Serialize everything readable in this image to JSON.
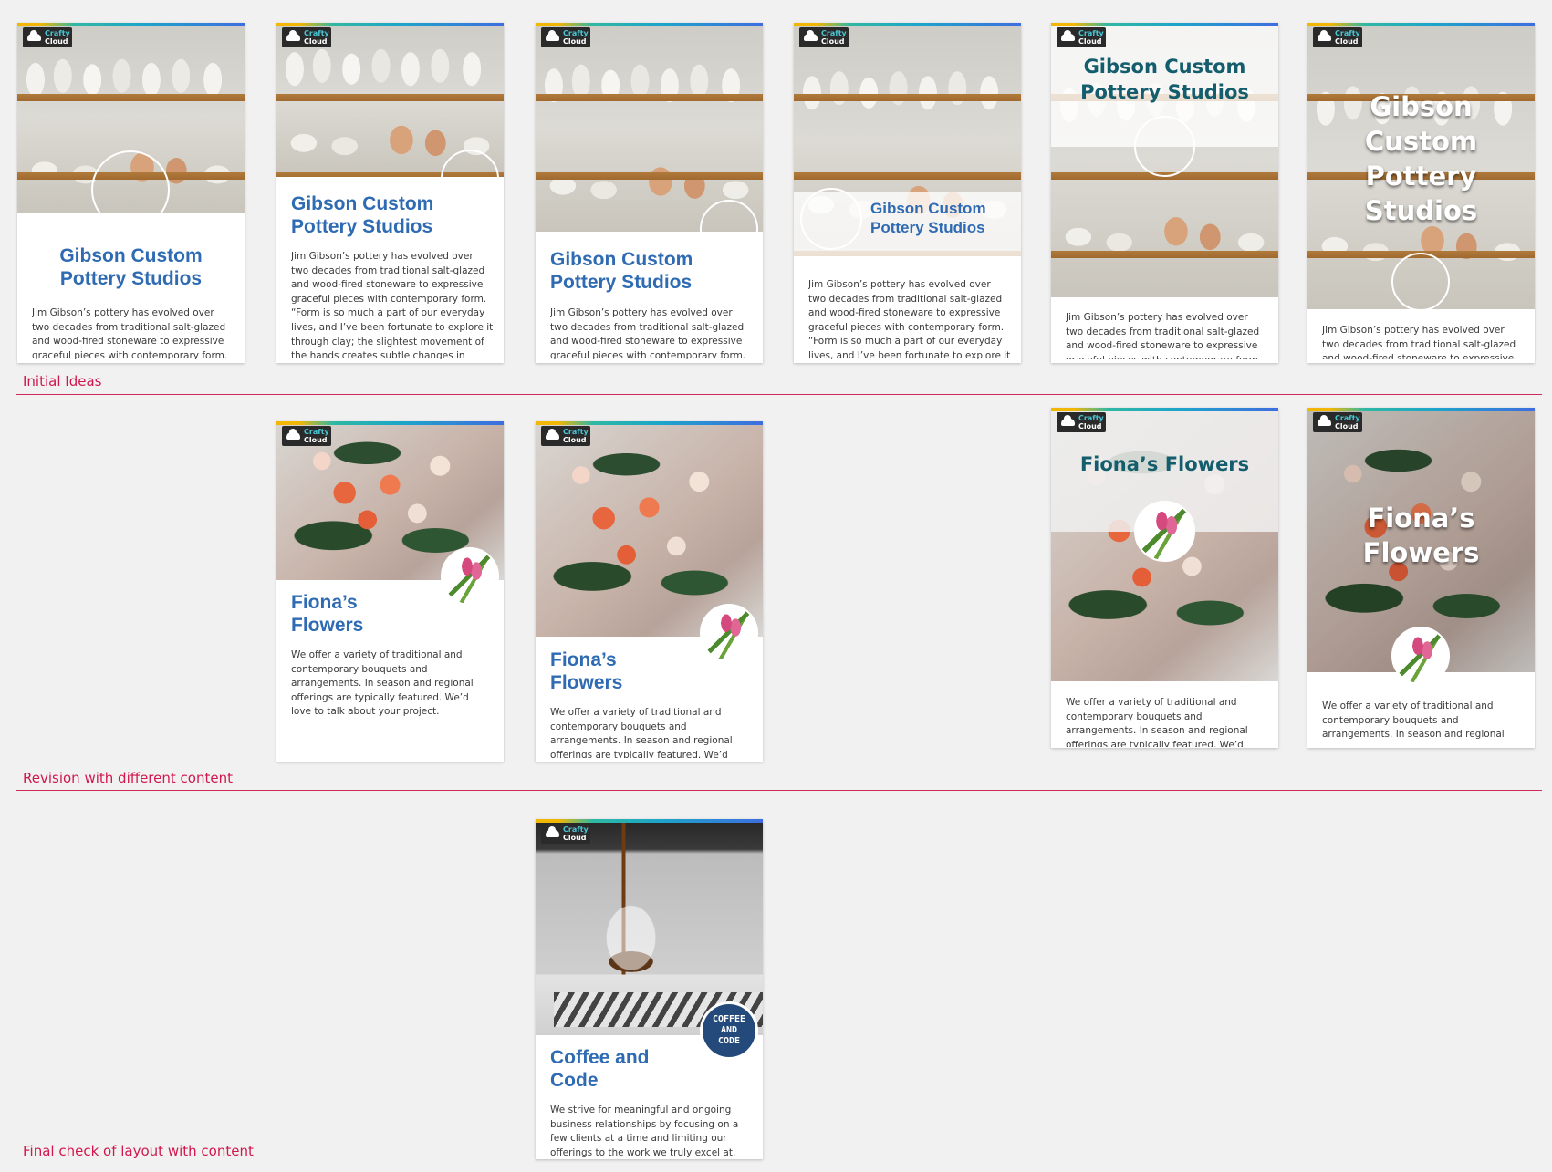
{
  "logo": {
    "line1": "Crafty",
    "line2": "Cloud"
  },
  "sections": {
    "initial": "Initial Ideas",
    "revision": "Revision with different content",
    "final": "Final check of layout with content"
  },
  "pottery": {
    "title": "Gibson Custom Pottery Studios",
    "title_lines": [
      "Gibson",
      "Custom",
      "Pottery",
      "Studios"
    ],
    "title_two_line": [
      "Gibson Custom",
      "Pottery Studios"
    ],
    "body": "Jim Gibson’s pottery has evolved over two decades from traditional salt-glazed and wood-fired stoneware to expressive graceful pieces with contemporary form. “Form is so much a part of our everyday lives, and I’ve been fortunate to explore it through clay; the slightest movement of the hands creates subtle changes in"
  },
  "flowers": {
    "title": "Fiona’s Flowers",
    "title_lines": [
      "Fiona’s",
      "Flowers"
    ],
    "body": "We offer a variety of traditional and contemporary bouquets and arrangements. In season and regional offerings are typically featured. We’d love to talk about your project."
  },
  "coffee": {
    "title_lines": [
      "Coffee and",
      "Code"
    ],
    "badge_lines": [
      "COFFEE",
      "AND",
      "CODE"
    ],
    "body": "We strive for meaningful and ongoing business relationships by focusing on a few clients at a time and limiting our offerings to the work we truly excel at."
  },
  "colors": {
    "accent_title": "#2f6bb3",
    "teal_title": "#135d6c",
    "section_label": "#d1184e",
    "badge": "#234a7a"
  }
}
